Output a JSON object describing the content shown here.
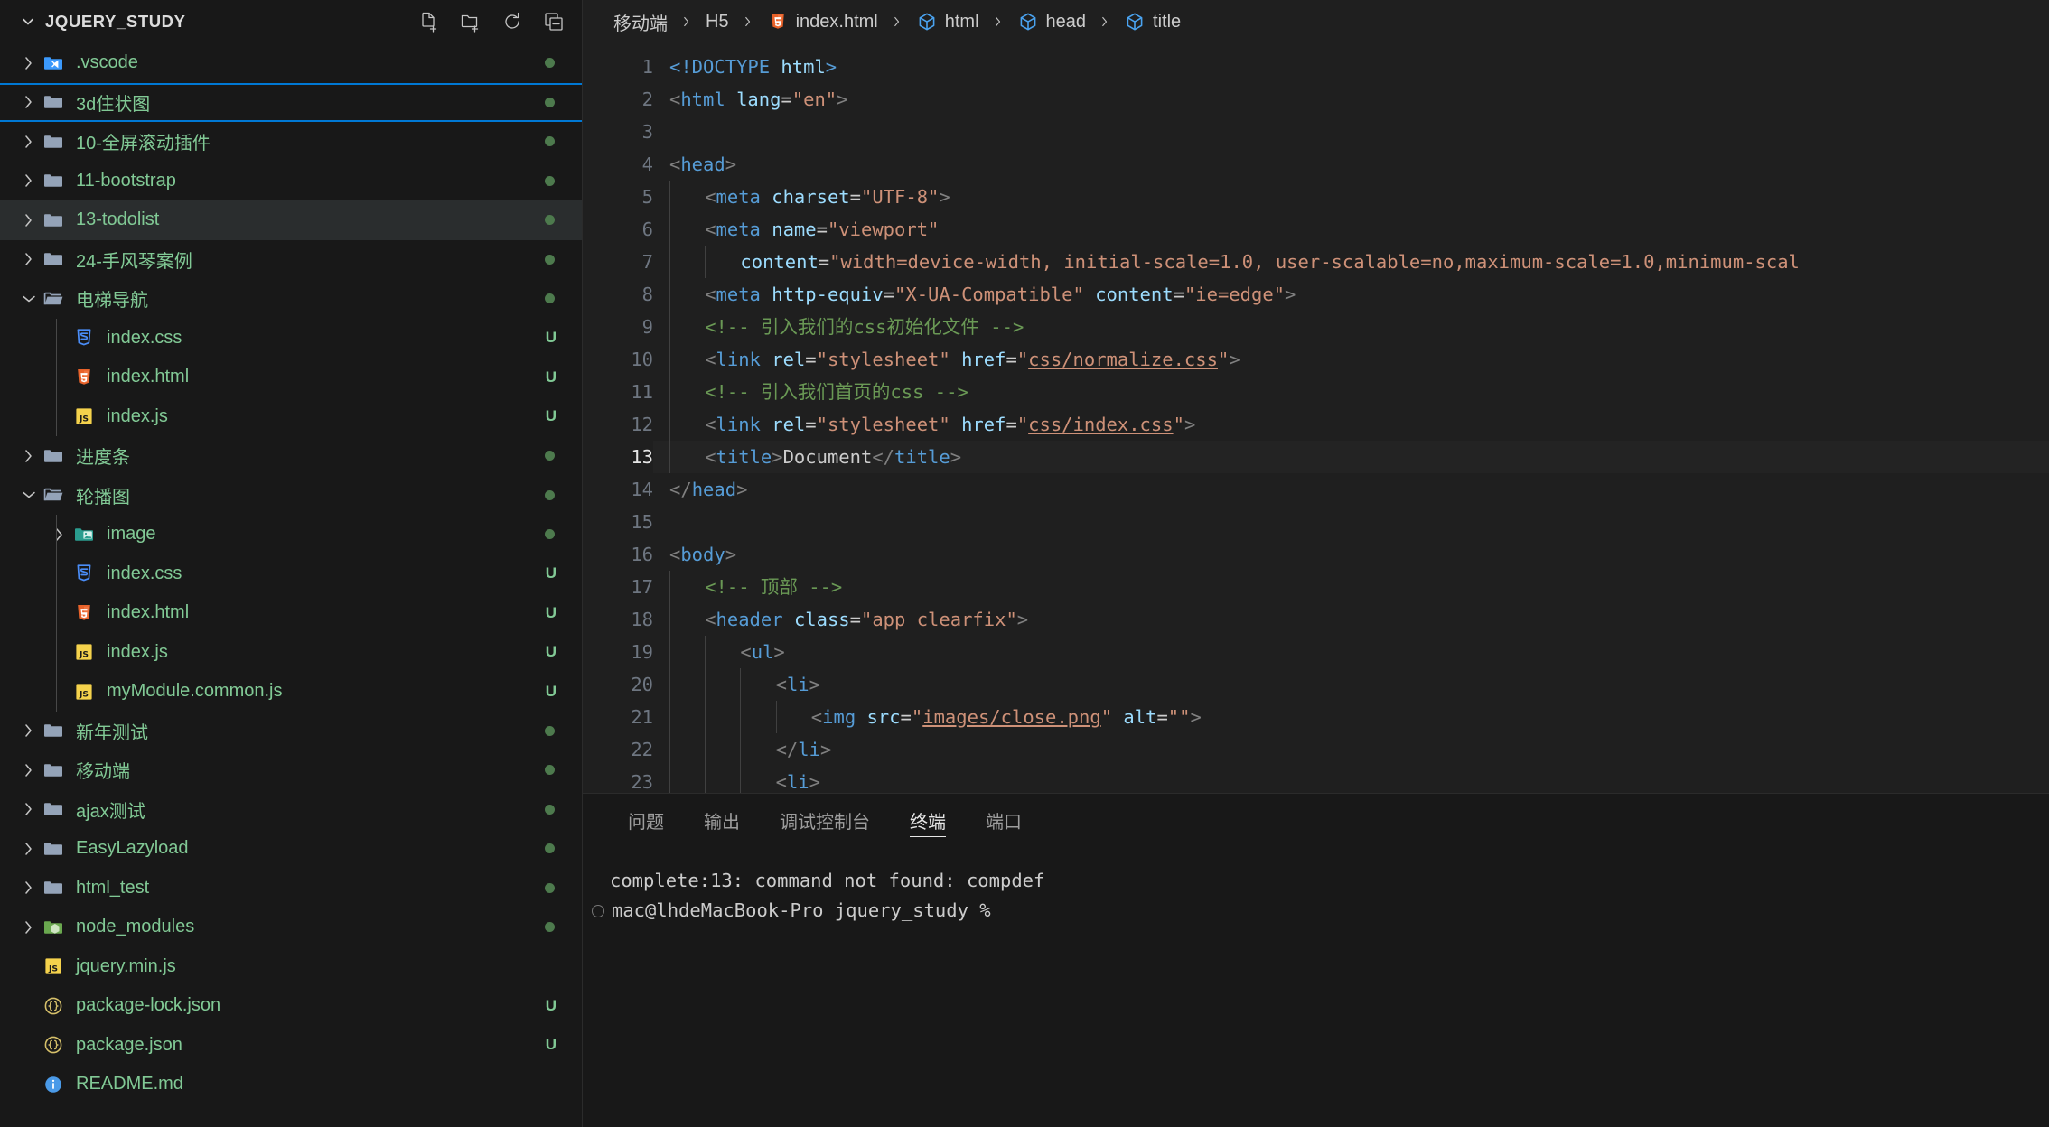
{
  "sidebar": {
    "title": "JQUERY_STUDY",
    "actions": [
      {
        "name": "new-file-icon",
        "label": "New File"
      },
      {
        "name": "new-folder-icon",
        "label": "New Folder"
      },
      {
        "name": "refresh-icon",
        "label": "Refresh Explorer"
      },
      {
        "name": "collapse-all-icon",
        "label": "Collapse Folders in Explorer"
      }
    ],
    "items": [
      {
        "label": ".vscode",
        "type": "folder",
        "icon": "vscode-folder-icon",
        "depth": 1,
        "expanded": false,
        "badge": "dot",
        "state": "normal"
      },
      {
        "label": "3d住状图",
        "type": "folder",
        "icon": "folder-closed-icon",
        "depth": 1,
        "expanded": false,
        "badge": "dot",
        "state": "focused"
      },
      {
        "label": "10-全屏滚动插件",
        "type": "folder",
        "icon": "folder-closed-icon",
        "depth": 1,
        "expanded": false,
        "badge": "dot",
        "state": "normal"
      },
      {
        "label": "11-bootstrap",
        "type": "folder",
        "icon": "folder-closed-icon",
        "depth": 1,
        "expanded": false,
        "badge": "dot",
        "state": "normal"
      },
      {
        "label": "13-todolist",
        "type": "folder",
        "icon": "folder-closed-icon",
        "depth": 1,
        "expanded": false,
        "badge": "dot",
        "state": "hover"
      },
      {
        "label": "24-手风琴案例",
        "type": "folder",
        "icon": "folder-closed-icon",
        "depth": 1,
        "expanded": false,
        "badge": "dot",
        "state": "normal"
      },
      {
        "label": "电梯导航",
        "type": "folder",
        "icon": "folder-open-icon",
        "depth": 1,
        "expanded": true,
        "badge": "dot",
        "state": "normal"
      },
      {
        "label": "index.css",
        "type": "file",
        "icon": "css-file-icon",
        "depth": 2,
        "badge": "U",
        "state": "normal"
      },
      {
        "label": "index.html",
        "type": "file",
        "icon": "html-file-icon",
        "depth": 2,
        "badge": "U",
        "state": "normal"
      },
      {
        "label": "index.js",
        "type": "file",
        "icon": "js-file-icon",
        "depth": 2,
        "badge": "U",
        "state": "normal"
      },
      {
        "label": "进度条",
        "type": "folder",
        "icon": "folder-closed-icon",
        "depth": 1,
        "expanded": false,
        "badge": "dot",
        "state": "normal"
      },
      {
        "label": "轮播图",
        "type": "folder",
        "icon": "folder-open-icon",
        "depth": 1,
        "expanded": true,
        "badge": "dot",
        "state": "normal"
      },
      {
        "label": "image",
        "type": "folder",
        "icon": "image-folder-icon",
        "depth": 2,
        "expanded": false,
        "badge": "dot",
        "state": "normal"
      },
      {
        "label": "index.css",
        "type": "file",
        "icon": "css-file-icon",
        "depth": 2,
        "badge": "U",
        "state": "normal"
      },
      {
        "label": "index.html",
        "type": "file",
        "icon": "html-file-icon",
        "depth": 2,
        "badge": "U",
        "state": "normal"
      },
      {
        "label": "index.js",
        "type": "file",
        "icon": "js-file-icon",
        "depth": 2,
        "badge": "U",
        "state": "normal"
      },
      {
        "label": "myModule.common.js",
        "type": "file",
        "icon": "js-file-icon",
        "depth": 2,
        "badge": "U",
        "state": "normal"
      },
      {
        "label": "新年测试",
        "type": "folder",
        "icon": "folder-closed-icon",
        "depth": 1,
        "expanded": false,
        "badge": "dot",
        "state": "normal"
      },
      {
        "label": "移动端",
        "type": "folder",
        "icon": "folder-closed-icon",
        "depth": 1,
        "expanded": false,
        "badge": "dot",
        "state": "normal"
      },
      {
        "label": "ajax测试",
        "type": "folder",
        "icon": "folder-closed-icon",
        "depth": 1,
        "expanded": false,
        "badge": "dot",
        "state": "normal"
      },
      {
        "label": "EasyLazyload",
        "type": "folder",
        "icon": "folder-closed-icon",
        "depth": 1,
        "expanded": false,
        "badge": "dot",
        "state": "normal"
      },
      {
        "label": "html_test",
        "type": "folder",
        "icon": "folder-closed-icon",
        "depth": 1,
        "expanded": false,
        "badge": "dot",
        "state": "normal"
      },
      {
        "label": "node_modules",
        "type": "folder",
        "icon": "node-folder-icon",
        "depth": 1,
        "expanded": false,
        "badge": "dot",
        "state": "normal"
      },
      {
        "label": "jquery.min.js",
        "type": "file",
        "icon": "js-file-icon",
        "depth": 1,
        "badge": "",
        "state": "normal"
      },
      {
        "label": "package-lock.json",
        "type": "file",
        "icon": "json-file-icon",
        "depth": 1,
        "badge": "U",
        "state": "normal"
      },
      {
        "label": "package.json",
        "type": "file",
        "icon": "json-file-icon",
        "depth": 1,
        "badge": "U",
        "state": "normal"
      },
      {
        "label": "README.md",
        "type": "file",
        "icon": "markdown-file-icon",
        "depth": 1,
        "badge": "",
        "state": "normal"
      }
    ]
  },
  "breadcrumb": [
    {
      "label": "移动端",
      "icon": null
    },
    {
      "label": "H5",
      "icon": null
    },
    {
      "label": "index.html",
      "icon": "html-file-icon"
    },
    {
      "label": "html",
      "icon": "symbol-cube-icon"
    },
    {
      "label": "head",
      "icon": "symbol-cube-icon"
    },
    {
      "label": "title",
      "icon": "symbol-cube-icon"
    }
  ],
  "editor": {
    "current_line": 13,
    "lines": [
      {
        "n": 1,
        "indent": 0,
        "segs": [
          {
            "t": "tag",
            "v": "<!DOCTYPE "
          },
          {
            "t": "attr",
            "v": "html"
          },
          {
            "t": "tag",
            "v": ">"
          }
        ]
      },
      {
        "n": 2,
        "indent": 0,
        "segs": [
          {
            "t": "br",
            "v": "<"
          },
          {
            "t": "tag",
            "v": "html "
          },
          {
            "t": "attr",
            "v": "lang"
          },
          {
            "t": "txt",
            "v": "="
          },
          {
            "t": "str",
            "v": "\"en\""
          },
          {
            "t": "br",
            "v": ">"
          }
        ]
      },
      {
        "n": 3,
        "indent": 0,
        "segs": []
      },
      {
        "n": 4,
        "indent": 0,
        "segs": [
          {
            "t": "br",
            "v": "<"
          },
          {
            "t": "tag",
            "v": "head"
          },
          {
            "t": "br",
            "v": ">"
          }
        ]
      },
      {
        "n": 5,
        "indent": 1,
        "segs": [
          {
            "t": "br",
            "v": "<"
          },
          {
            "t": "tag",
            "v": "meta "
          },
          {
            "t": "attr",
            "v": "charset"
          },
          {
            "t": "txt",
            "v": "="
          },
          {
            "t": "str",
            "v": "\"UTF-8\""
          },
          {
            "t": "br",
            "v": ">"
          }
        ]
      },
      {
        "n": 6,
        "indent": 1,
        "segs": [
          {
            "t": "br",
            "v": "<"
          },
          {
            "t": "tag",
            "v": "meta "
          },
          {
            "t": "attr",
            "v": "name"
          },
          {
            "t": "txt",
            "v": "="
          },
          {
            "t": "str",
            "v": "\"viewport\""
          }
        ]
      },
      {
        "n": 7,
        "indent": 2,
        "segs": [
          {
            "t": "attr",
            "v": "content"
          },
          {
            "t": "txt",
            "v": "="
          },
          {
            "t": "str",
            "v": "\"width=device-width, initial-scale=1.0, user-scalable=no,maximum-scale=1.0,minimum-scal"
          }
        ]
      },
      {
        "n": 8,
        "indent": 1,
        "segs": [
          {
            "t": "br",
            "v": "<"
          },
          {
            "t": "tag",
            "v": "meta "
          },
          {
            "t": "attr",
            "v": "http-equiv"
          },
          {
            "t": "txt",
            "v": "="
          },
          {
            "t": "str",
            "v": "\"X-UA-Compatible\""
          },
          {
            "t": "txt",
            "v": " "
          },
          {
            "t": "attr",
            "v": "content"
          },
          {
            "t": "txt",
            "v": "="
          },
          {
            "t": "str",
            "v": "\"ie=edge\""
          },
          {
            "t": "br",
            "v": ">"
          }
        ]
      },
      {
        "n": 9,
        "indent": 1,
        "segs": [
          {
            "t": "com",
            "v": "<!-- 引入我们的css初始化文件 -->"
          }
        ]
      },
      {
        "n": 10,
        "indent": 1,
        "segs": [
          {
            "t": "br",
            "v": "<"
          },
          {
            "t": "tag",
            "v": "link "
          },
          {
            "t": "attr",
            "v": "rel"
          },
          {
            "t": "txt",
            "v": "="
          },
          {
            "t": "str",
            "v": "\"stylesheet\""
          },
          {
            "t": "txt",
            "v": " "
          },
          {
            "t": "attr",
            "v": "href"
          },
          {
            "t": "txt",
            "v": "="
          },
          {
            "t": "str",
            "v": "\""
          },
          {
            "t": "lnk",
            "v": "css/normalize.css"
          },
          {
            "t": "str",
            "v": "\""
          },
          {
            "t": "br",
            "v": ">"
          }
        ]
      },
      {
        "n": 11,
        "indent": 1,
        "segs": [
          {
            "t": "com",
            "v": "<!-- 引入我们首页的css -->"
          }
        ]
      },
      {
        "n": 12,
        "indent": 1,
        "segs": [
          {
            "t": "br",
            "v": "<"
          },
          {
            "t": "tag",
            "v": "link "
          },
          {
            "t": "attr",
            "v": "rel"
          },
          {
            "t": "txt",
            "v": "="
          },
          {
            "t": "str",
            "v": "\"stylesheet\""
          },
          {
            "t": "txt",
            "v": " "
          },
          {
            "t": "attr",
            "v": "href"
          },
          {
            "t": "txt",
            "v": "="
          },
          {
            "t": "str",
            "v": "\""
          },
          {
            "t": "lnk",
            "v": "css/index.css"
          },
          {
            "t": "str",
            "v": "\""
          },
          {
            "t": "br",
            "v": ">"
          }
        ]
      },
      {
        "n": 13,
        "indent": 1,
        "segs": [
          {
            "t": "br",
            "v": "<"
          },
          {
            "t": "tag",
            "v": "title"
          },
          {
            "t": "br",
            "v": ">"
          },
          {
            "t": "txt",
            "v": "Document"
          },
          {
            "t": "br",
            "v": "</"
          },
          {
            "t": "tag",
            "v": "title"
          },
          {
            "t": "br",
            "v": ">"
          }
        ]
      },
      {
        "n": 14,
        "indent": 0,
        "segs": [
          {
            "t": "br",
            "v": "</"
          },
          {
            "t": "tag",
            "v": "head"
          },
          {
            "t": "br",
            "v": ">"
          }
        ]
      },
      {
        "n": 15,
        "indent": 0,
        "segs": []
      },
      {
        "n": 16,
        "indent": 0,
        "segs": [
          {
            "t": "br",
            "v": "<"
          },
          {
            "t": "tag",
            "v": "body"
          },
          {
            "t": "br",
            "v": ">"
          }
        ]
      },
      {
        "n": 17,
        "indent": 1,
        "segs": [
          {
            "t": "com",
            "v": "<!-- 顶部 -->"
          }
        ]
      },
      {
        "n": 18,
        "indent": 1,
        "segs": [
          {
            "t": "br",
            "v": "<"
          },
          {
            "t": "tag",
            "v": "header "
          },
          {
            "t": "attr",
            "v": "class"
          },
          {
            "t": "txt",
            "v": "="
          },
          {
            "t": "str",
            "v": "\"app clearfix\""
          },
          {
            "t": "br",
            "v": ">"
          }
        ]
      },
      {
        "n": 19,
        "indent": 2,
        "segs": [
          {
            "t": "br",
            "v": "<"
          },
          {
            "t": "tag",
            "v": "ul"
          },
          {
            "t": "br",
            "v": ">"
          }
        ]
      },
      {
        "n": 20,
        "indent": 3,
        "segs": [
          {
            "t": "br",
            "v": "<"
          },
          {
            "t": "tag",
            "v": "li"
          },
          {
            "t": "br",
            "v": ">"
          }
        ]
      },
      {
        "n": 21,
        "indent": 4,
        "segs": [
          {
            "t": "br",
            "v": "<"
          },
          {
            "t": "tag",
            "v": "img "
          },
          {
            "t": "attr",
            "v": "src"
          },
          {
            "t": "txt",
            "v": "="
          },
          {
            "t": "str",
            "v": "\""
          },
          {
            "t": "lnk",
            "v": "images/close.png"
          },
          {
            "t": "str",
            "v": "\""
          },
          {
            "t": "txt",
            "v": " "
          },
          {
            "t": "attr",
            "v": "alt"
          },
          {
            "t": "txt",
            "v": "="
          },
          {
            "t": "str",
            "v": "\"\""
          },
          {
            "t": "br",
            "v": ">"
          }
        ]
      },
      {
        "n": 22,
        "indent": 3,
        "segs": [
          {
            "t": "br",
            "v": "</"
          },
          {
            "t": "tag",
            "v": "li"
          },
          {
            "t": "br",
            "v": ">"
          }
        ]
      },
      {
        "n": 23,
        "indent": 3,
        "segs": [
          {
            "t": "br",
            "v": "<"
          },
          {
            "t": "tag",
            "v": "li"
          },
          {
            "t": "br",
            "v": ">"
          }
        ]
      }
    ]
  },
  "panel": {
    "tabs": [
      {
        "label": "问题",
        "active": false
      },
      {
        "label": "输出",
        "active": false
      },
      {
        "label": "调试控制台",
        "active": false
      },
      {
        "label": "终端",
        "active": true
      },
      {
        "label": "端口",
        "active": false
      }
    ],
    "terminal_lines": [
      {
        "text": "complete:13: command not found: compdef",
        "prompt": false
      },
      {
        "text": "mac@lhdeMacBook-Pro jquery_study % ",
        "prompt": true
      }
    ]
  },
  "colors": {
    "accent": "#0078d4",
    "sidebar_bg": "#181818",
    "editor_bg": "#1f1f1f",
    "tag": "#569cd6",
    "attr": "#9cdcfe",
    "string": "#ce9178",
    "comment": "#6a9955",
    "tree_text": "#81c995",
    "modified_badge": "#81c995"
  }
}
